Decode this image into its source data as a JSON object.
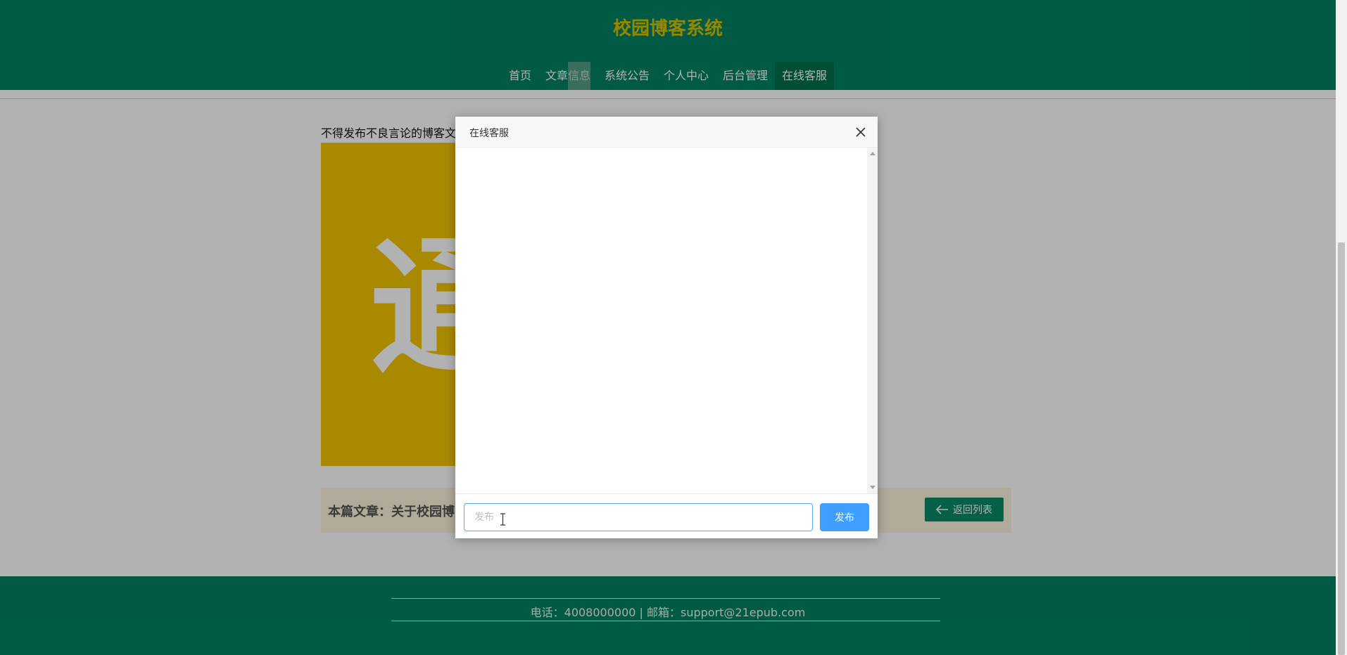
{
  "header": {
    "site_title": "校园博客系统",
    "nav": [
      {
        "label": "首页"
      },
      {
        "label": "文章信息"
      },
      {
        "label": "系统公告"
      },
      {
        "label": "个人中心"
      },
      {
        "label": "后台管理"
      },
      {
        "label": "在线客服",
        "active": true
      }
    ]
  },
  "content": {
    "notice": "不得发布不良言论的博客文",
    "cover_glyph": "通",
    "article_label": "本篇文章：关于校园博",
    "back_button": "返回列表"
  },
  "footer": {
    "contact": "电话：4008000000 | 邮箱：support@21epub.com"
  },
  "modal": {
    "title": "在线客服",
    "input_placeholder": "发布",
    "send_label": "发布"
  },
  "colors": {
    "brand_green": "#008262",
    "title_yellow": "#d9c200",
    "send_blue": "#409eff"
  }
}
